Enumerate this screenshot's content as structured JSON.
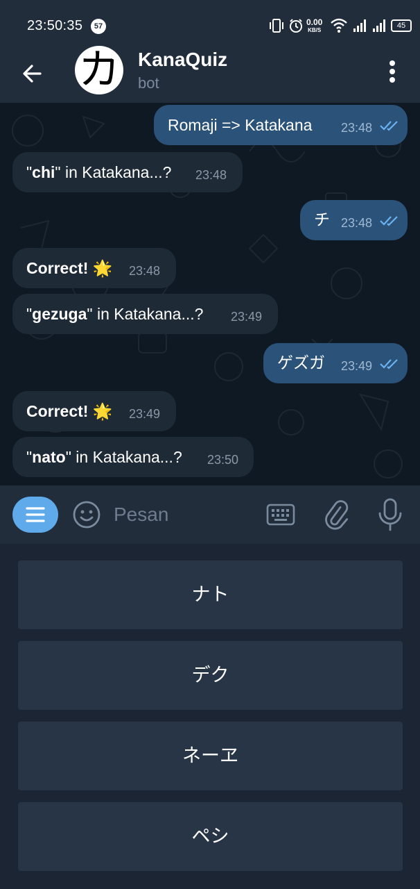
{
  "status_bar": {
    "time": "23:50:35",
    "notification_count": "57",
    "net_speed_value": "0.00",
    "net_speed_unit": "KB/S",
    "battery": "45"
  },
  "header": {
    "title": "KanaQuiz",
    "subtitle": "bot",
    "avatar_glyph": "カ"
  },
  "messages": [
    {
      "text": "Romaji => Katakana",
      "time": "23:48"
    },
    {
      "bold": "chi",
      "suffix": " in Katakana...?",
      "time": "23:48"
    },
    {
      "text": "チ",
      "time": "23:48"
    },
    {
      "text": "Correct! 🌟",
      "time": "23:48"
    },
    {
      "bold": "gezuga",
      "suffix": " in Katakana...?",
      "time": "23:49"
    },
    {
      "text": "ゲズガ",
      "time": "23:49"
    },
    {
      "text": "Correct! 🌟",
      "time": "23:49"
    },
    {
      "bold": "nato",
      "suffix": " in Katakana...?",
      "time": "23:50"
    }
  ],
  "input": {
    "placeholder": "Pesan"
  },
  "reply_keyboard": [
    "ナト",
    "デク",
    "ネーヱ",
    "ペシ"
  ],
  "colors": {
    "accent": "#5eaaea",
    "outgoing_bubble": "#2b5278",
    "incoming_bubble": "#1f2a37",
    "header_bg": "#212d3b"
  }
}
